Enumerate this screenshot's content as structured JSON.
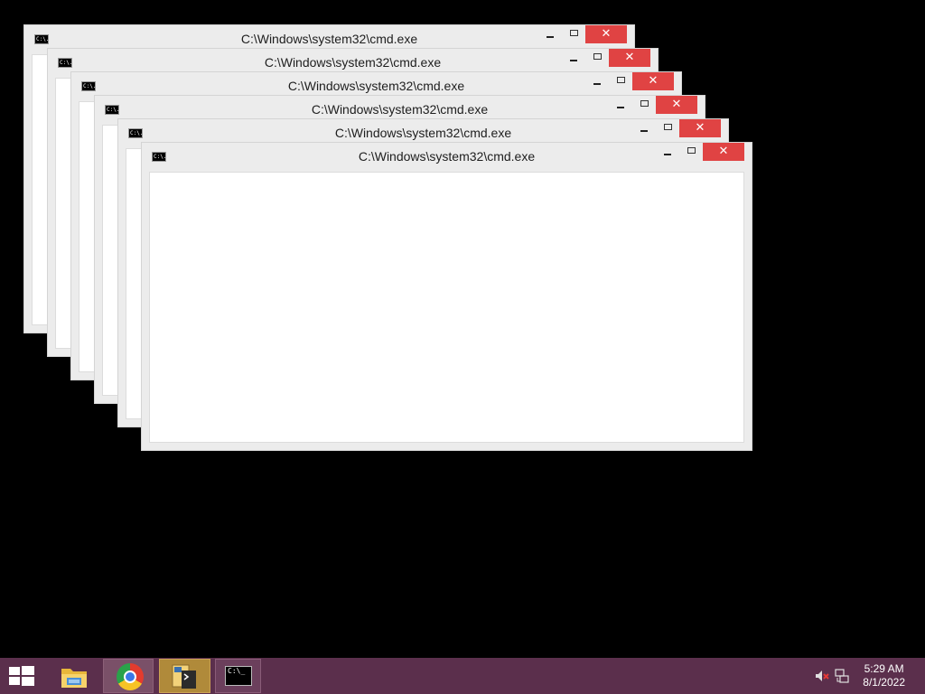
{
  "windows": [
    {
      "title": "C:\\Windows\\system32\\cmd.exe",
      "icon": "cmd-icon",
      "icon_text": "C:\\."
    },
    {
      "title": "C:\\Windows\\system32\\cmd.exe",
      "icon": "cmd-icon",
      "icon_text": "C:\\."
    },
    {
      "title": "C:\\Windows\\system32\\cmd.exe",
      "icon": "cmd-icon",
      "icon_text": "C:\\."
    },
    {
      "title": "C:\\Windows\\system32\\cmd.exe",
      "icon": "cmd-icon",
      "icon_text": "C:\\."
    },
    {
      "title": "C:\\Windows\\system32\\cmd.exe",
      "icon": "cmd-icon",
      "icon_text": "C:\\."
    },
    {
      "title": "C:\\Windows\\system32\\cmd.exe",
      "icon": "cmd-icon",
      "icon_text": "C:\\."
    }
  ],
  "window_controls": {
    "close_glyph": "✕"
  },
  "taskbar": {
    "start_icon": "windows-logo-icon",
    "apps": [
      {
        "name": "File Explorer",
        "icon": "folder-icon"
      },
      {
        "name": "Google Chrome",
        "icon": "chrome-icon",
        "active": true
      },
      {
        "name": "Python app",
        "icon": "python-icon",
        "active": true
      },
      {
        "name": "Command Prompt",
        "icon": "cmd-icon",
        "active": true,
        "icon_text": "C:\\_"
      }
    ],
    "tray": {
      "volume_icon": "volume-muted-icon",
      "network_icon": "network-icon",
      "time": "5:29 AM",
      "date": "8/1/2022"
    }
  },
  "colors": {
    "taskbar": "#5b2f4c",
    "close_button": "#e04343",
    "window_frame": "#ececec",
    "desktop": "#000000"
  }
}
